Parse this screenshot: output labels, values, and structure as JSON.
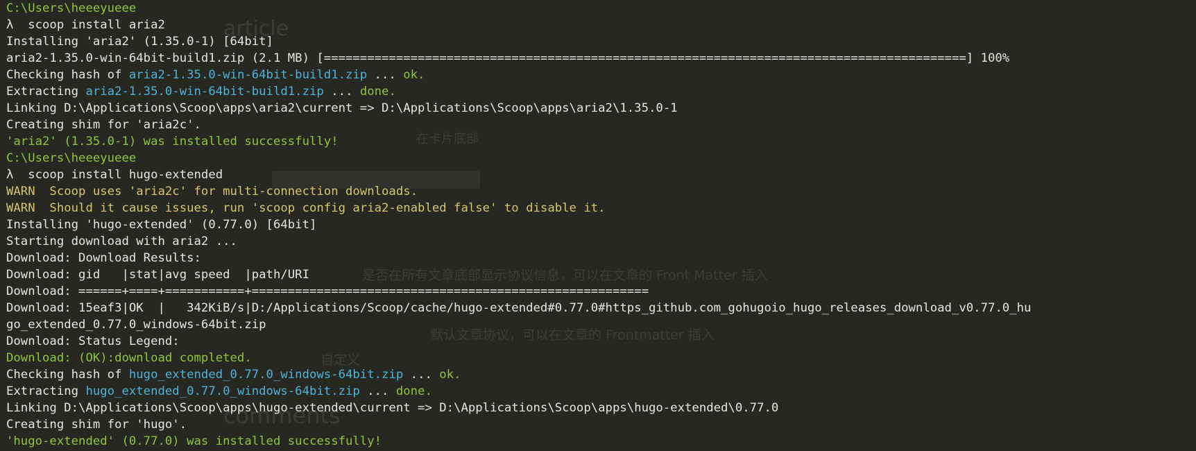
{
  "colors": {
    "background": "#272822",
    "text": "#e6e6e6",
    "path_green": "#8ec63f",
    "warn_yellow": "#d7c56f",
    "file_cyan": "#4fb3d9"
  },
  "background_ghost": {
    "heading_article": "article",
    "line_a": "在卡片底部",
    "line_b": "是否在所有文章底部显示协议信息，可以在文章的 Front Matter 插入",
    "line_c": "默认文章协议，可以在文章的 Frontmatter 插入",
    "line_d": "自定义",
    "heading_comments": "comments"
  },
  "session": [
    {
      "prompt_path": "C:\\Users\\heeeyueee",
      "prompt_symbol": "λ",
      "command": "scoop install aria2",
      "output": [
        {
          "type": "plain",
          "text": "Installing 'aria2' (1.35.0-1) [64bit]"
        },
        {
          "type": "plain",
          "text": "aria2-1.35.0-win-64bit-build1.zip (2.1 MB) [=========================================================================================] 100%"
        },
        {
          "type": "hash",
          "prefix": "Checking hash of ",
          "file": "aria2-1.35.0-win-64bit-build1.zip",
          "suffix": " ... ",
          "status": "ok."
        },
        {
          "type": "hash",
          "prefix": "Extracting ",
          "file": "aria2-1.35.0-win-64bit-build1.zip",
          "suffix": " ... ",
          "status": "done."
        },
        {
          "type": "plain",
          "text": "Linking D:\\Applications\\Scoop\\apps\\aria2\\current => D:\\Applications\\Scoop\\apps\\aria2\\1.35.0-1"
        },
        {
          "type": "plain",
          "text": "Creating shim for 'aria2c'."
        },
        {
          "type": "success",
          "text": "'aria2' (1.35.0-1) was installed successfully!"
        }
      ]
    },
    {
      "prompt_path": "C:\\Users\\heeeyueee",
      "prompt_symbol": "λ",
      "command": "scoop install hugo-extended",
      "output": [
        {
          "type": "warn",
          "text": "WARN  Scoop uses 'aria2c' for multi-connection downloads."
        },
        {
          "type": "warn",
          "text": "WARN  Should it cause issues, run 'scoop config aria2-enabled false' to disable it."
        },
        {
          "type": "plain",
          "text": "Installing 'hugo-extended' (0.77.0) [64bit]"
        },
        {
          "type": "plain",
          "text": "Starting download with aria2 ..."
        },
        {
          "type": "plain",
          "text": "Download: Download Results:"
        },
        {
          "type": "plain",
          "text": "Download: gid   |stat|avg speed  |path/URI"
        },
        {
          "type": "plain",
          "text": "Download: ======+====+===========+======================================================="
        },
        {
          "type": "plain",
          "text": "Download: 15eaf3|OK  |   342KiB/s|D:/Applications/Scoop/cache/hugo-extended#0.77.0#https_github.com_gohugoio_hugo_releases_download_v0.77.0_hu"
        },
        {
          "type": "plain",
          "text": "go_extended_0.77.0_windows-64bit.zip"
        },
        {
          "type": "plain",
          "text": "Download: Status Legend:"
        },
        {
          "type": "success",
          "text": "Download: (OK):download completed."
        },
        {
          "type": "hash",
          "prefix": "Checking hash of ",
          "file": "hugo_extended_0.77.0_windows-64bit.zip",
          "suffix": " ... ",
          "status": "ok."
        },
        {
          "type": "hash",
          "prefix": "Extracting ",
          "file": "hugo_extended_0.77.0_windows-64bit.zip",
          "suffix": " ... ",
          "status": "done."
        },
        {
          "type": "plain",
          "text": "Linking D:\\Applications\\Scoop\\apps\\hugo-extended\\current => D:\\Applications\\Scoop\\apps\\hugo-extended\\0.77.0"
        },
        {
          "type": "plain",
          "text": "Creating shim for 'hugo'."
        },
        {
          "type": "success",
          "text": "'hugo-extended' (0.77.0) was installed successfully!"
        }
      ]
    }
  ]
}
